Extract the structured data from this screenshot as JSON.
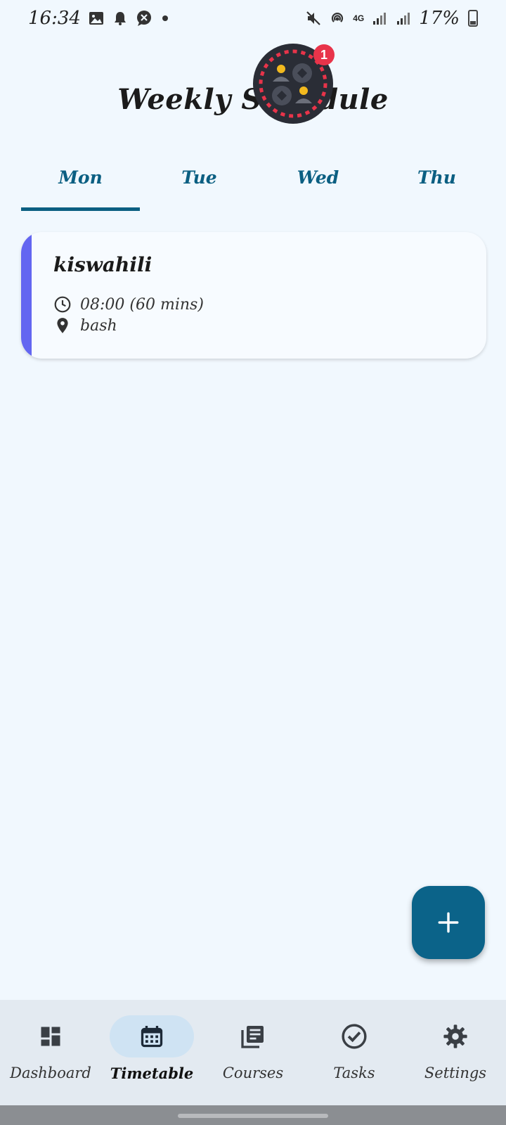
{
  "status_bar": {
    "time": "16:34",
    "battery_percent": "17%",
    "network": "4G",
    "icons_left": [
      "image-icon",
      "bell-icon",
      "chat-icon",
      "dot-icon"
    ],
    "icons_right": [
      "mute-icon",
      "hotspot-icon",
      "network-4g-icon",
      "signal-icon",
      "signal-icon",
      "battery-icon"
    ]
  },
  "header": {
    "title": "Weekly Schedule"
  },
  "chat_bubble": {
    "badge_count": "1"
  },
  "tabs": [
    {
      "label": "Mon",
      "active": true
    },
    {
      "label": "Tue",
      "active": false
    },
    {
      "label": "Wed",
      "active": false
    },
    {
      "label": "Thu",
      "active": false
    }
  ],
  "classes": [
    {
      "title": "kiswahili",
      "time": "08:00 (60 mins)",
      "location": "bash",
      "accent_color": "#6366f1"
    }
  ],
  "fab": {
    "icon": "plus-icon"
  },
  "bottom_nav": {
    "items": [
      {
        "label": "Dashboard",
        "icon": "dashboard-icon",
        "active": false
      },
      {
        "label": "Timetable",
        "icon": "calendar-icon",
        "active": true
      },
      {
        "label": "Courses",
        "icon": "courses-icon",
        "active": false
      },
      {
        "label": "Tasks",
        "icon": "check-circle-icon",
        "active": false
      },
      {
        "label": "Settings",
        "icon": "gear-icon",
        "active": false
      }
    ]
  },
  "colors": {
    "primary": "#0b6389",
    "background": "#f1f8fe",
    "card_accent": "#6366f1",
    "badge": "#e8344a"
  }
}
